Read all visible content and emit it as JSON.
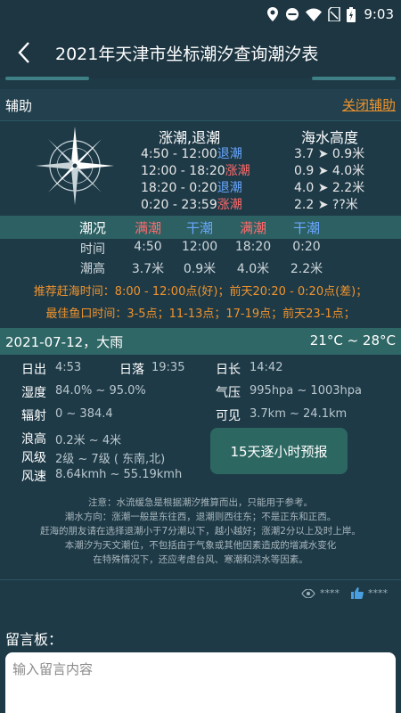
{
  "status_bar": {
    "time": "9:03"
  },
  "header": {
    "title": "2021年天津市坐标潮汐查询潮汐表"
  },
  "helper": {
    "label": "辅助",
    "close_label": "关闭辅助"
  },
  "summary": {
    "tide_title": "涨潮,退潮",
    "height_title": "海水高度",
    "rows": [
      {
        "time": "4:50 - 12:00",
        "type": "退潮",
        "height": "3.7 ➤ 0.9米",
        "kind": "fall"
      },
      {
        "time": "12:00 - 18:20",
        "type": "涨潮",
        "height": "0.9 ➤ 4.0米",
        "kind": "rise"
      },
      {
        "time": "18:20 - 0:20",
        "type": "退潮",
        "height": "4.0 ➤ 2.2米",
        "kind": "fall"
      },
      {
        "time": "0:20 - 23:59",
        "type": "涨潮",
        "height": "2.2 ➤ ??米",
        "kind": "rise"
      }
    ]
  },
  "tide_table": {
    "status_label": "潮况",
    "statuses": [
      "满潮",
      "干潮",
      "满潮",
      "干潮"
    ],
    "time_label": "时间",
    "times": [
      "4:50",
      "12:00",
      "18:20",
      "0:20"
    ],
    "height_label": "潮高",
    "heights": [
      "3.7米",
      "0.9米",
      "4.0米",
      "2.2米"
    ]
  },
  "advice": {
    "best_beach": "推荐赶海时间：8:00 - 12:00点(好)；前天20:20 - 0:20点(差)；",
    "best_fishing": "最佳鱼口时间：3-5点；11-13点；17-19点；前天23-1点；"
  },
  "weather": {
    "date_weather": "2021-07-12，大雨",
    "temp": "21°C ~ 28°C",
    "sunrise_label": "日出",
    "sunrise": "4:53",
    "sunset_label": "日落",
    "sunset": "19:35",
    "daylength_label": "日长",
    "daylength": "14:42",
    "humidity_label": "湿度",
    "humidity": "84.0% ~ 95.0%",
    "pressure_label": "气压",
    "pressure": "995hpa ~ 1003hpa",
    "radiation_label": "辐射",
    "radiation": "0 ~ 384.4",
    "visibility_label": "可见",
    "visibility": "3.7km ~ 24.1km",
    "wave_label": "浪高",
    "wave": "0.2米 ~ 4米",
    "wind_level_label": "风级",
    "wind_level": "2级 ~ 7级 ( 东南,北)",
    "wind_speed_label": "风速",
    "wind_speed": "8.64kmh ~ 55.19kmh",
    "forecast_button": "15天逐小时预报"
  },
  "notes": [
    "注意：水流缓急是根据潮汐推算而出，只能用于参考。",
    "潮水方向：涨潮一般是东往西，退潮则西往东；不是正东和正西。",
    "赶海的朋友请在选择退潮小于7分潮以下，越小越好；涨潮2分以上及时上岸。",
    "本潮汐为天文潮位，不包括由于气象或其他因素造成的增减水变化",
    "在特殊情况下，还应考虑台风、寒潮和洪水等因素。"
  ],
  "stats": {
    "views": "****",
    "likes": "****"
  },
  "board": {
    "label": "留言板：",
    "placeholder": "输入留言内容"
  },
  "colors": {
    "rise": "#ff6b6b",
    "fall": "#6aa8ff",
    "accent": "#f0932c",
    "teal": "#2f6766"
  },
  "icons": [
    "location-icon",
    "dnd-icon",
    "wifi-icon",
    "no-sim-icon",
    "battery-icon",
    "back-arrow-icon",
    "compass-icon",
    "eye-icon",
    "thumbs-up-icon"
  ]
}
